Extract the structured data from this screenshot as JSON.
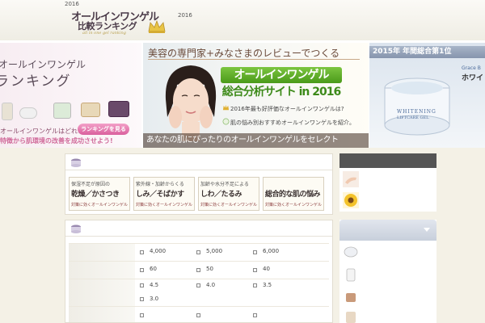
{
  "header": {
    "year_left": "2016",
    "year_right": "2016",
    "logo_main": "オールインワンゲル",
    "logo_sub": "比較ランキング",
    "logo_tagline": "all in one gel ranking"
  },
  "banner": {
    "left": {
      "title_line1": "オールインワンゲル",
      "title_line2": "ランキング",
      "question": "オールインワンゲルはどれ?",
      "button_label": "ランキングを見る",
      "bottom_text": "特徴から肌環境の改善を成功させよう!"
    },
    "main": {
      "title": "美容の専門家+みなさまのレビューでつくる",
      "headline_1": "オールインワンゲル",
      "headline_2": "総合分析サイト in 2016",
      "note_1": "2016年最も好評価なオールインワンゲルは?",
      "note_2": "肌の悩み別おすすめオールインワンゲルを紹介。",
      "footer": "あなたの肌にぴったりのオールインワンゲルをセレクト"
    },
    "right": {
      "title": "2015年 年間総合第1位",
      "brand": "Grace B",
      "product": "ホワイ",
      "jar_label_1": "WHITENING",
      "jar_label_2": "LIFTCARE GEL"
    }
  },
  "category_tiles": [
    {
      "top": "保湿不足が原因の",
      "main": "乾燥／かさつき",
      "sub": "対策に効くオールインワンゲル"
    },
    {
      "top": "紫外線・加齢からくる",
      "main": "しみ／そばかす",
      "sub": "対策に効くオールインワンゲル"
    },
    {
      "top": "加齢や水分不足による",
      "main": "しわ／たるみ",
      "sub": "対策に効くオールインワンゲル"
    },
    {
      "top": "",
      "main": "総合的な肌の悩み",
      "sub": "対策に効くオールインワンゲル"
    }
  ],
  "filter_rows": [
    {
      "cells": [
        "4,000",
        "5,000",
        "6,000"
      ]
    },
    {
      "cells": [
        "60",
        "50",
        "40"
      ]
    },
    {
      "cells": [
        "4.5",
        "4.0",
        "3.5",
        "3.0"
      ]
    },
    {
      "cells": [
        "",
        "",
        ""
      ]
    }
  ],
  "colors": {
    "page_bg": "#f4f1e6",
    "accent_green": "#5aab24",
    "accent_pink": "#d9609d",
    "ranking_blue": "#8694ad"
  }
}
